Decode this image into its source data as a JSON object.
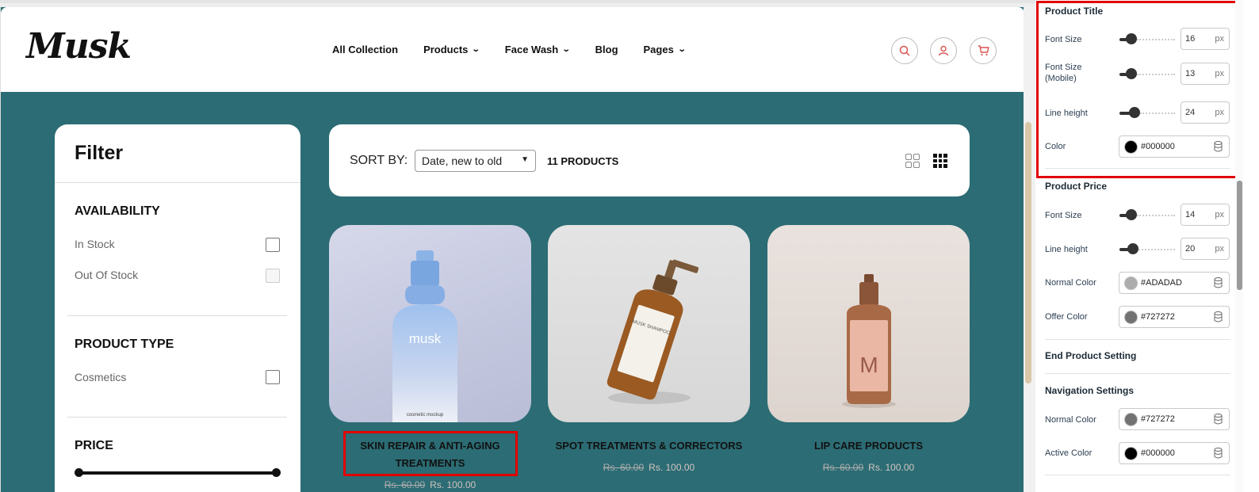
{
  "store": {
    "logo": "Musk",
    "nav": [
      {
        "label": "All Collection",
        "chevron": false
      },
      {
        "label": "Products",
        "chevron": true
      },
      {
        "label": "Face Wash",
        "chevron": true
      },
      {
        "label": "Blog",
        "chevron": false
      },
      {
        "label": "Pages",
        "chevron": true
      }
    ],
    "header_icons": [
      "search-icon",
      "account-icon",
      "cart-icon"
    ],
    "accent_color": "#2C6C74",
    "icon_color": "#D9534F"
  },
  "filter": {
    "title": "Filter",
    "availability": {
      "title": "AVAILABILITY",
      "options": [
        "In Stock",
        "Out Of Stock"
      ]
    },
    "product_type": {
      "title": "PRODUCT TYPE",
      "options": [
        "Cosmetics"
      ]
    },
    "price": {
      "title": "PRICE"
    }
  },
  "toolbar": {
    "sort_label": "SORT BY:",
    "sort_value": "Date, new to old",
    "count": "11 PRODUCTS"
  },
  "products": [
    {
      "name": "SKIN REPAIR & ANTI-AGING TREATMENTS",
      "old_price": "Rs. 60.00",
      "offer_price": "Rs. 100.00",
      "brand": "musk",
      "caption": "cosmetic mockup"
    },
    {
      "name": "SPOT TREATMENTS & CORRECTORS",
      "old_price": "Rs. 60.00",
      "offer_price": "Rs. 100.00",
      "label_text": "MUSK SHAMPOO"
    },
    {
      "name": "LIP CARE PRODUCTS",
      "old_price": "Rs. 60.00",
      "offer_price": "Rs. 100.00",
      "letter": "M"
    }
  ],
  "settings": {
    "product_title": {
      "heading": "Product Title",
      "font_size": {
        "label": "Font Size",
        "value": "16",
        "unit": "px"
      },
      "font_size_mobile": {
        "label": "Font Size (Mobile)",
        "value": "13",
        "unit": "px"
      },
      "line_height": {
        "label": "Line height",
        "value": "24",
        "unit": "px"
      },
      "color": {
        "label": "Color",
        "value": "#000000"
      }
    },
    "product_price": {
      "heading": "Product Price",
      "font_size": {
        "label": "Font Size",
        "value": "14",
        "unit": "px"
      },
      "line_height": {
        "label": "Line height",
        "value": "20",
        "unit": "px"
      },
      "normal_color": {
        "label": "Normal Color",
        "value": "#ADADAD"
      },
      "offer_color": {
        "label": "Offer Color",
        "value": "#727272"
      }
    },
    "end_product": {
      "heading": "End Product Setting"
    },
    "navigation": {
      "heading": "Navigation Settings",
      "normal_color": {
        "label": "Normal Color",
        "value": "#727272"
      },
      "active_color": {
        "label": "Active Color",
        "value": "#000000"
      }
    },
    "highlight_color": "#E10000"
  }
}
